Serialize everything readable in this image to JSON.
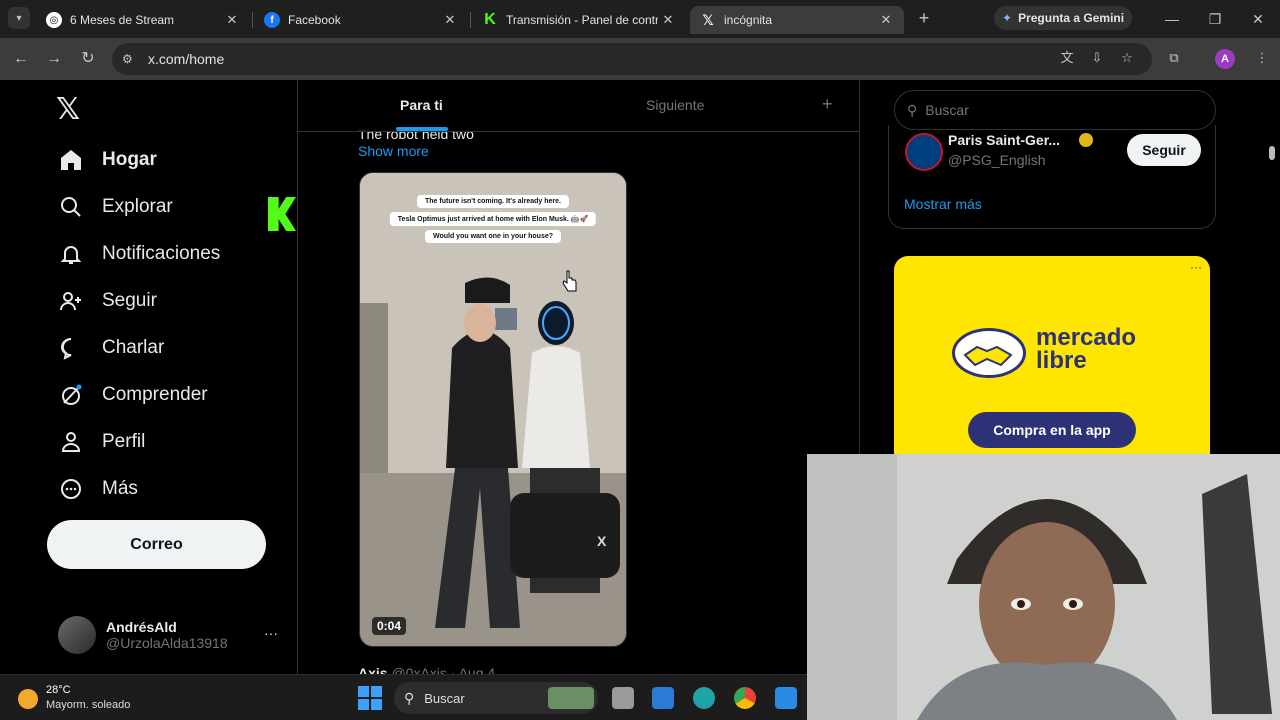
{
  "browser": {
    "tabs": [
      {
        "title": "6 Meses de Stream",
        "icon": "chatgpt-icon",
        "active": false
      },
      {
        "title": "Facebook",
        "icon": "facebook-icon",
        "active": false
      },
      {
        "title": "Transmisión - Panel de control",
        "icon": "kick-icon",
        "active": false
      },
      {
        "title": "incógnita",
        "icon": "x-icon",
        "active": true
      }
    ],
    "new_tab": "+",
    "gemini_label": "Pregunta a Gemini",
    "url": "x.com/home",
    "profile_initial": "A",
    "colors": {
      "frame": "#1f1f1f",
      "toolbar": "#3c3c3c",
      "profile": "#9c3ac0"
    }
  },
  "x": {
    "nav": [
      {
        "label": "Hogar",
        "icon": "home-icon",
        "bold": true
      },
      {
        "label": "Explorar",
        "icon": "search-icon",
        "bold": false
      },
      {
        "label": "Notificaciones",
        "icon": "bell-icon",
        "bold": false
      },
      {
        "label": "Seguir",
        "icon": "follow-icon",
        "bold": false
      },
      {
        "label": "Charlar",
        "icon": "chat-icon",
        "bold": false
      },
      {
        "label": "Comprender",
        "icon": "grok-icon",
        "bold": false
      },
      {
        "label": "Perfil",
        "icon": "person-icon",
        "bold": false
      },
      {
        "label": "Más",
        "icon": "more-circle-icon",
        "bold": false
      }
    ],
    "compose_label": "Correo",
    "account": {
      "name": "AndrésAld",
      "handle": "@UrzolaAlda13918",
      "more": "···"
    },
    "feed_tabs": {
      "active": "Para ti",
      "inactive": "Siguiente",
      "add": "+"
    },
    "post": {
      "text_fragment": "The robot held two",
      "show_more": "Show more",
      "captions": [
        "The future isn't coming. It's already here.",
        "Tesla Optimus just arrived at home with Elon Musk. 🤖🚀",
        "Would you want one in your house?"
      ],
      "video_time": "0:04"
    },
    "next_post": {
      "name": "Axis",
      "meta": "@0xAxis · Aug 4"
    },
    "right": {
      "search_placeholder": "Buscar",
      "suggestion": {
        "name": "Paris Saint-Ger...",
        "handle": "@PSG_English",
        "button": "Seguir"
      },
      "show_more": "Mostrar más",
      "ad": {
        "brand_line1": "mercado",
        "brand_line2": "libre",
        "cta": "Compra en la app",
        "more": "···"
      }
    },
    "colors": {
      "accent": "#1d9bf0",
      "border": "#2f3336",
      "muted": "#71767b",
      "ad_bg": "#ffe600",
      "ad_brand": "#2d3277"
    }
  },
  "overlay": {
    "kick_count": "2",
    "kick_color": "#53fc18"
  },
  "taskbar": {
    "weather_temp": "28°C",
    "weather_desc": "Mayorm. soleado",
    "search_placeholder": "Buscar"
  }
}
